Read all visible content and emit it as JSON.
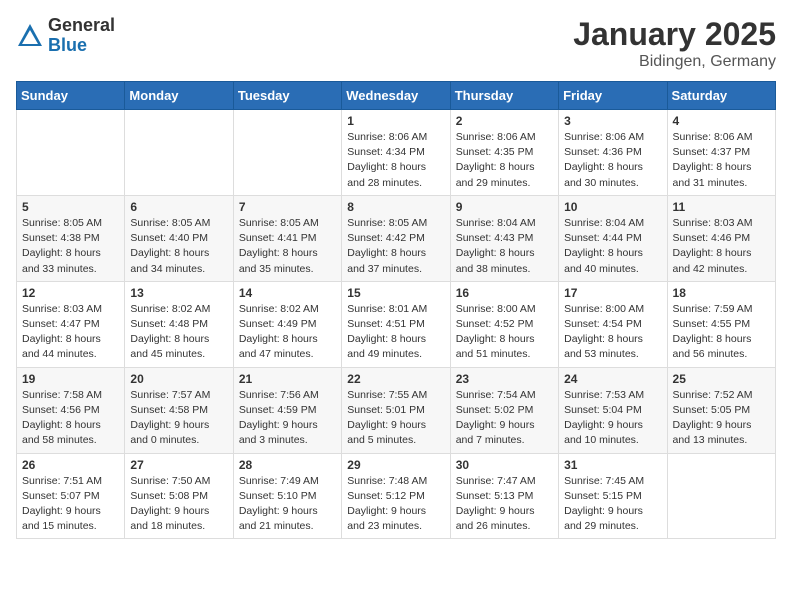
{
  "header": {
    "logo_general": "General",
    "logo_blue": "Blue",
    "main_title": "January 2025",
    "subtitle": "Bidingen, Germany"
  },
  "days_of_week": [
    "Sunday",
    "Monday",
    "Tuesday",
    "Wednesday",
    "Thursday",
    "Friday",
    "Saturday"
  ],
  "weeks": [
    [
      {
        "day": "",
        "info": ""
      },
      {
        "day": "",
        "info": ""
      },
      {
        "day": "",
        "info": ""
      },
      {
        "day": "1",
        "info": "Sunrise: 8:06 AM\nSunset: 4:34 PM\nDaylight: 8 hours\nand 28 minutes."
      },
      {
        "day": "2",
        "info": "Sunrise: 8:06 AM\nSunset: 4:35 PM\nDaylight: 8 hours\nand 29 minutes."
      },
      {
        "day": "3",
        "info": "Sunrise: 8:06 AM\nSunset: 4:36 PM\nDaylight: 8 hours\nand 30 minutes."
      },
      {
        "day": "4",
        "info": "Sunrise: 8:06 AM\nSunset: 4:37 PM\nDaylight: 8 hours\nand 31 minutes."
      }
    ],
    [
      {
        "day": "5",
        "info": "Sunrise: 8:05 AM\nSunset: 4:38 PM\nDaylight: 8 hours\nand 33 minutes."
      },
      {
        "day": "6",
        "info": "Sunrise: 8:05 AM\nSunset: 4:40 PM\nDaylight: 8 hours\nand 34 minutes."
      },
      {
        "day": "7",
        "info": "Sunrise: 8:05 AM\nSunset: 4:41 PM\nDaylight: 8 hours\nand 35 minutes."
      },
      {
        "day": "8",
        "info": "Sunrise: 8:05 AM\nSunset: 4:42 PM\nDaylight: 8 hours\nand 37 minutes."
      },
      {
        "day": "9",
        "info": "Sunrise: 8:04 AM\nSunset: 4:43 PM\nDaylight: 8 hours\nand 38 minutes."
      },
      {
        "day": "10",
        "info": "Sunrise: 8:04 AM\nSunset: 4:44 PM\nDaylight: 8 hours\nand 40 minutes."
      },
      {
        "day": "11",
        "info": "Sunrise: 8:03 AM\nSunset: 4:46 PM\nDaylight: 8 hours\nand 42 minutes."
      }
    ],
    [
      {
        "day": "12",
        "info": "Sunrise: 8:03 AM\nSunset: 4:47 PM\nDaylight: 8 hours\nand 44 minutes."
      },
      {
        "day": "13",
        "info": "Sunrise: 8:02 AM\nSunset: 4:48 PM\nDaylight: 8 hours\nand 45 minutes."
      },
      {
        "day": "14",
        "info": "Sunrise: 8:02 AM\nSunset: 4:49 PM\nDaylight: 8 hours\nand 47 minutes."
      },
      {
        "day": "15",
        "info": "Sunrise: 8:01 AM\nSunset: 4:51 PM\nDaylight: 8 hours\nand 49 minutes."
      },
      {
        "day": "16",
        "info": "Sunrise: 8:00 AM\nSunset: 4:52 PM\nDaylight: 8 hours\nand 51 minutes."
      },
      {
        "day": "17",
        "info": "Sunrise: 8:00 AM\nSunset: 4:54 PM\nDaylight: 8 hours\nand 53 minutes."
      },
      {
        "day": "18",
        "info": "Sunrise: 7:59 AM\nSunset: 4:55 PM\nDaylight: 8 hours\nand 56 minutes."
      }
    ],
    [
      {
        "day": "19",
        "info": "Sunrise: 7:58 AM\nSunset: 4:56 PM\nDaylight: 8 hours\nand 58 minutes."
      },
      {
        "day": "20",
        "info": "Sunrise: 7:57 AM\nSunset: 4:58 PM\nDaylight: 9 hours\nand 0 minutes."
      },
      {
        "day": "21",
        "info": "Sunrise: 7:56 AM\nSunset: 4:59 PM\nDaylight: 9 hours\nand 3 minutes."
      },
      {
        "day": "22",
        "info": "Sunrise: 7:55 AM\nSunset: 5:01 PM\nDaylight: 9 hours\nand 5 minutes."
      },
      {
        "day": "23",
        "info": "Sunrise: 7:54 AM\nSunset: 5:02 PM\nDaylight: 9 hours\nand 7 minutes."
      },
      {
        "day": "24",
        "info": "Sunrise: 7:53 AM\nSunset: 5:04 PM\nDaylight: 9 hours\nand 10 minutes."
      },
      {
        "day": "25",
        "info": "Sunrise: 7:52 AM\nSunset: 5:05 PM\nDaylight: 9 hours\nand 13 minutes."
      }
    ],
    [
      {
        "day": "26",
        "info": "Sunrise: 7:51 AM\nSunset: 5:07 PM\nDaylight: 9 hours\nand 15 minutes."
      },
      {
        "day": "27",
        "info": "Sunrise: 7:50 AM\nSunset: 5:08 PM\nDaylight: 9 hours\nand 18 minutes."
      },
      {
        "day": "28",
        "info": "Sunrise: 7:49 AM\nSunset: 5:10 PM\nDaylight: 9 hours\nand 21 minutes."
      },
      {
        "day": "29",
        "info": "Sunrise: 7:48 AM\nSunset: 5:12 PM\nDaylight: 9 hours\nand 23 minutes."
      },
      {
        "day": "30",
        "info": "Sunrise: 7:47 AM\nSunset: 5:13 PM\nDaylight: 9 hours\nand 26 minutes."
      },
      {
        "day": "31",
        "info": "Sunrise: 7:45 AM\nSunset: 5:15 PM\nDaylight: 9 hours\nand 29 minutes."
      },
      {
        "day": "",
        "info": ""
      }
    ]
  ]
}
